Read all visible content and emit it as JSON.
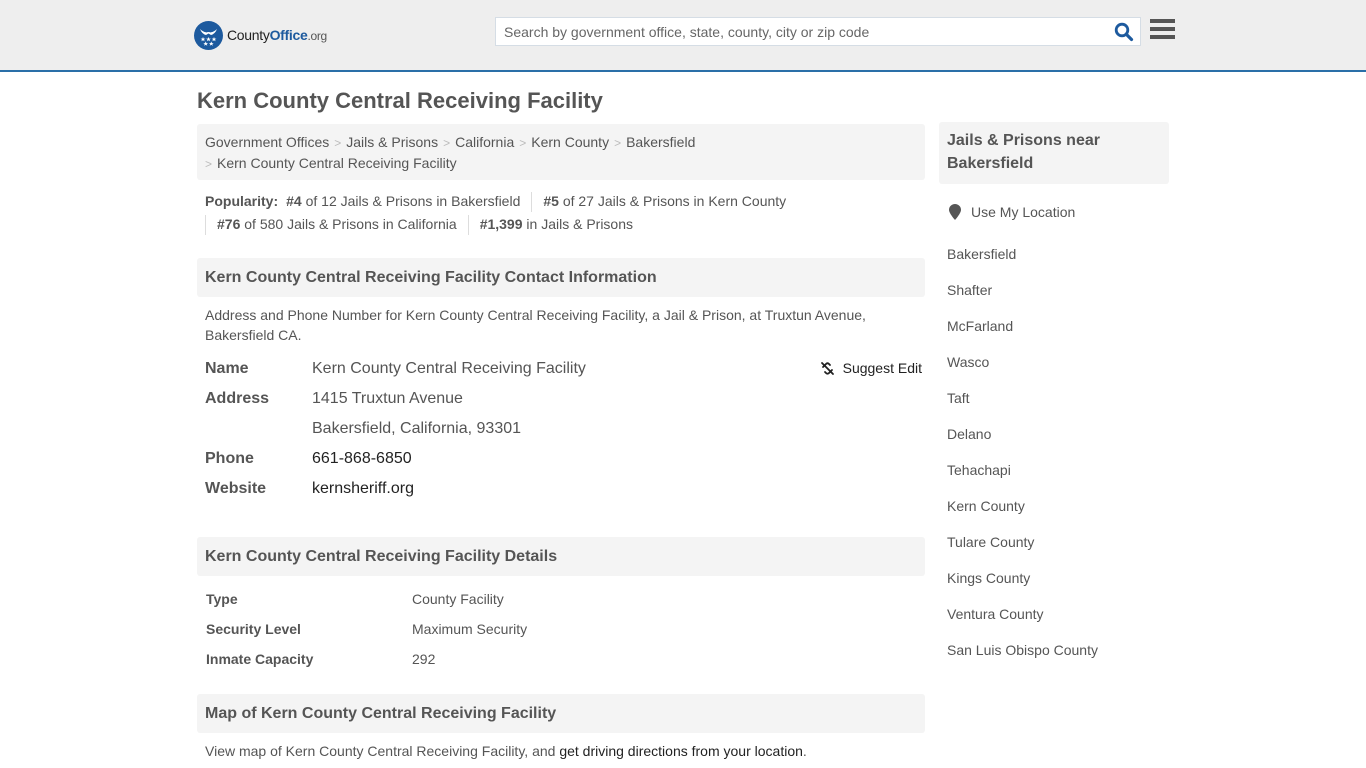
{
  "header": {
    "logo": {
      "prefix": "County",
      "brand": "Office",
      "tld": ".org"
    },
    "search": {
      "placeholder": "Search by government office, state, county, city or zip code",
      "value": ""
    },
    "icons": {
      "search": "search-icon",
      "menu": "hamburger-menu-icon"
    },
    "colors": {
      "accent": "#1d5a9e",
      "rule": "#2a6fa8"
    }
  },
  "page": {
    "title": "Kern County Central Receiving Facility"
  },
  "breadcrumb": [
    {
      "label": "Government Offices"
    },
    {
      "label": "Jails & Prisons"
    },
    {
      "label": "California"
    },
    {
      "label": "Kern County"
    },
    {
      "label": "Bakersfield"
    },
    {
      "label": "Kern County Central Receiving Facility"
    }
  ],
  "popularity": {
    "label": "Popularity:",
    "items": [
      {
        "rank": "#4",
        "text": " of 12 Jails & Prisons in Bakersfield"
      },
      {
        "rank": "#5",
        "text": " of 27 Jails & Prisons in Kern County"
      },
      {
        "rank": "#76",
        "text": " of 580 Jails & Prisons in California"
      },
      {
        "rank": "#1,399",
        "text": " in Jails & Prisons"
      }
    ]
  },
  "contact": {
    "heading": "Kern County Central Receiving Facility Contact Information",
    "description": "Address and Phone Number for Kern County Central Receiving Facility, a Jail & Prison, at Truxtun Avenue, Bakersfield CA.",
    "suggest_edit": "Suggest Edit",
    "labels": {
      "name": "Name",
      "address": "Address",
      "phone": "Phone",
      "website": "Website"
    },
    "name": "Kern County Central Receiving Facility",
    "address_line1": "1415 Truxtun Avenue",
    "address_line2": "Bakersfield, California, 93301",
    "phone": "661-868-6850",
    "website": "kernsheriff.org"
  },
  "details": {
    "heading": "Kern County Central Receiving Facility Details",
    "rows": [
      {
        "label": "Type",
        "value": "County Facility"
      },
      {
        "label": "Security Level",
        "value": "Maximum Security"
      },
      {
        "label": "Inmate Capacity",
        "value": "292"
      }
    ]
  },
  "map": {
    "heading": "Map of Kern County Central Receiving Facility",
    "text_before": "View map of Kern County Central Receiving Facility, and ",
    "link": "get driving directions from your location",
    "text_after": "."
  },
  "sidebar": {
    "heading": "Jails & Prisons near Bakersfield",
    "use_location": "Use My Location",
    "items": [
      {
        "label": "Bakersfield"
      },
      {
        "label": "Shafter"
      },
      {
        "label": "McFarland"
      },
      {
        "label": "Wasco"
      },
      {
        "label": "Taft"
      },
      {
        "label": "Delano"
      },
      {
        "label": "Tehachapi"
      },
      {
        "label": "Kern County"
      },
      {
        "label": "Tulare County"
      },
      {
        "label": "Kings County"
      },
      {
        "label": "Ventura County"
      },
      {
        "label": "San Luis Obispo County"
      }
    ]
  }
}
